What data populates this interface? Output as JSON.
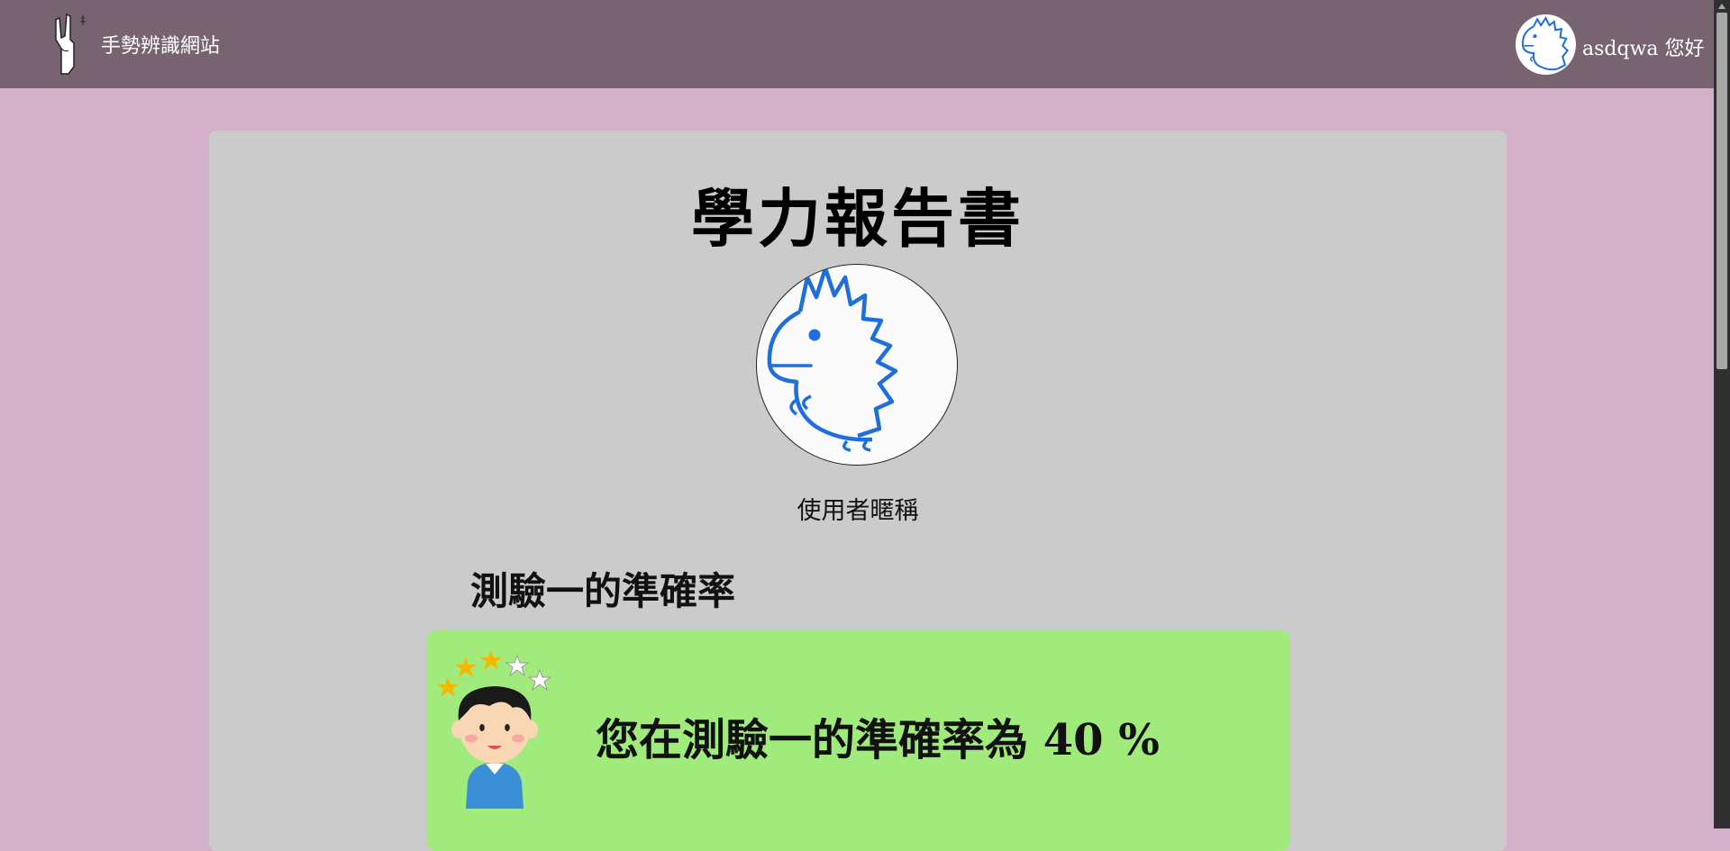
{
  "navbar": {
    "site_title": "手勢辨識網站",
    "greeting": "asdqwa 您好"
  },
  "report": {
    "title": "學力報告書",
    "nickname": "使用者暱稱",
    "section_heading": "測驗一的準確率",
    "result_text": "您在測驗一的準確率為 40 %",
    "accuracy_percent": 40
  },
  "colors": {
    "page_bg": "#d1b0c8",
    "navbar_bg": "#786370",
    "card_bg": "#cbcbcb",
    "result_bg": "#a0eb7c",
    "avatar_stroke": "#1e6fdc"
  },
  "icons": {
    "logo": "rock-hand-icon",
    "avatar": "dinosaur-doodle-icon",
    "illustration": "dizzy-boy-illustration"
  }
}
